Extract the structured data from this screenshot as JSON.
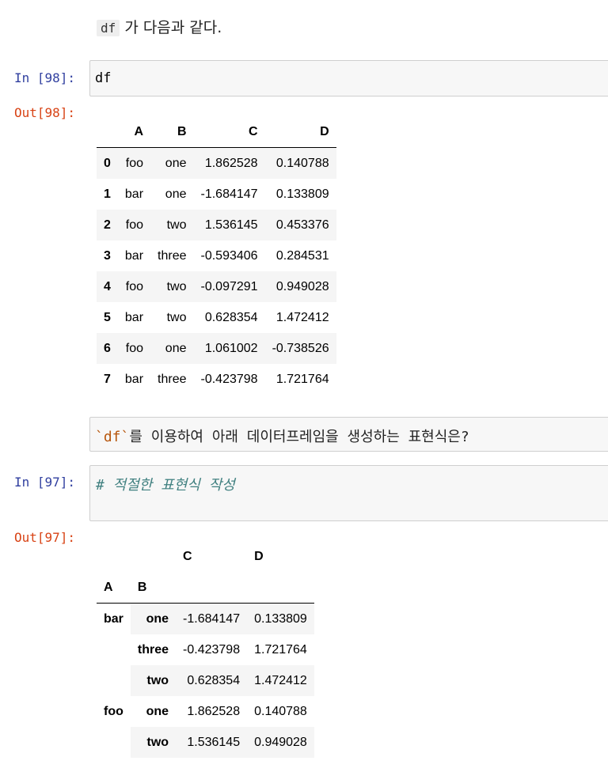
{
  "md1": {
    "code": "df",
    "text": "가 다음과 같다."
  },
  "cell98": {
    "in_prompt": "In [98]:",
    "code": "df",
    "out_prompt": "Out[98]:"
  },
  "table1": {
    "columns": [
      "A",
      "B",
      "C",
      "D"
    ],
    "rows": [
      {
        "index": "0",
        "A": "foo",
        "B": "one",
        "C": "1.862528",
        "D": "0.140788"
      },
      {
        "index": "1",
        "A": "bar",
        "B": "one",
        "C": "-1.684147",
        "D": "0.133809"
      },
      {
        "index": "2",
        "A": "foo",
        "B": "two",
        "C": "1.536145",
        "D": "0.453376"
      },
      {
        "index": "3",
        "A": "bar",
        "B": "three",
        "C": "-0.593406",
        "D": "0.284531"
      },
      {
        "index": "4",
        "A": "foo",
        "B": "two",
        "C": "-0.097291",
        "D": "0.949028"
      },
      {
        "index": "5",
        "A": "bar",
        "B": "two",
        "C": "0.628354",
        "D": "1.472412"
      },
      {
        "index": "6",
        "A": "foo",
        "B": "one",
        "C": "1.061002",
        "D": "-0.738526"
      },
      {
        "index": "7",
        "A": "bar",
        "B": "three",
        "C": "-0.423798",
        "D": "1.721764"
      }
    ]
  },
  "md2": {
    "text": "`df`를 이용하여 아래 데이터프레임을 생성하는 표현식은?"
  },
  "cell97": {
    "in_prompt": "In [97]:",
    "comment": "# 적절한 표현식 작성",
    "out_prompt": "Out[97]:"
  },
  "table2": {
    "value_columns": [
      "C",
      "D"
    ],
    "index_names": [
      "A",
      "B"
    ],
    "groups": [
      {
        "A": "bar",
        "rows": [
          {
            "B": "one",
            "C": "-1.684147",
            "D": "0.133809"
          },
          {
            "B": "three",
            "C": "-0.423798",
            "D": "1.721764"
          },
          {
            "B": "two",
            "C": "0.628354",
            "D": "1.472412"
          }
        ]
      },
      {
        "A": "foo",
        "rows": [
          {
            "B": "one",
            "C": "1.862528",
            "D": "0.140788"
          },
          {
            "B": "two",
            "C": "1.536145",
            "D": "0.949028"
          }
        ]
      }
    ]
  }
}
